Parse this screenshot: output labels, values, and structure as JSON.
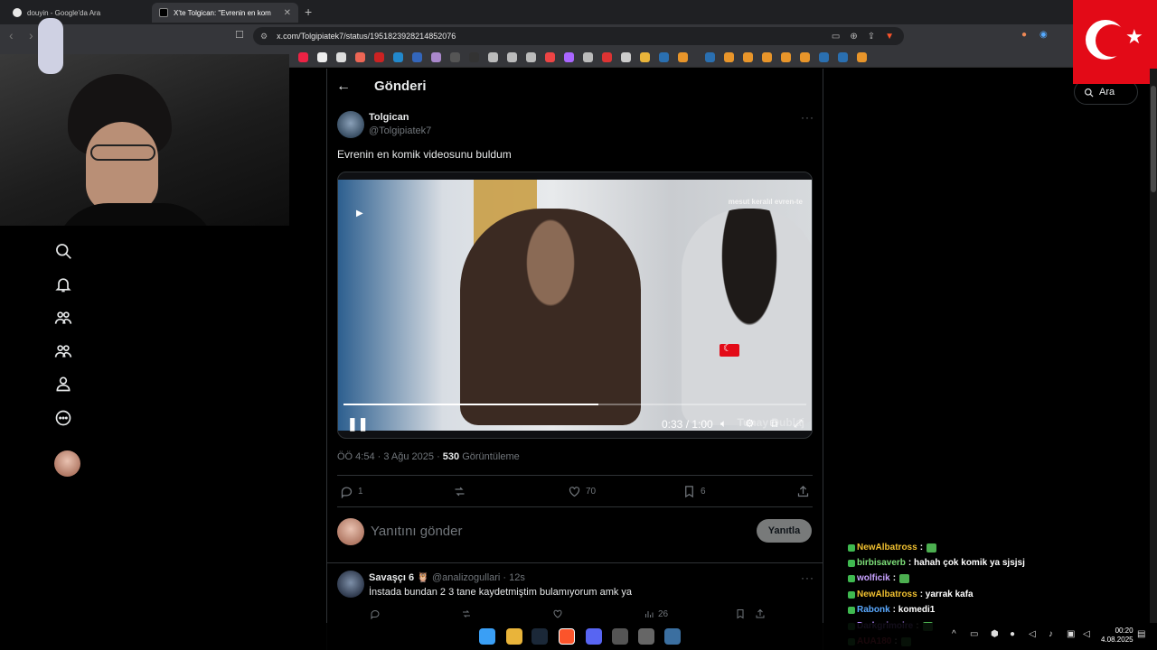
{
  "browser": {
    "tabs": [
      {
        "title": "douyin - Google'da Ara",
        "active": false
      },
      {
        "title": "X'te Tolgican: \"Evrenin en kom",
        "active": true
      }
    ],
    "url": "x.com/Tolgipiatek7/status/1951823928214852076"
  },
  "header": {
    "back": "←",
    "title": "Gönderi"
  },
  "tweet": {
    "author_name": "Tolgican",
    "author_handle": "@Tolgipiatek7",
    "text": "Evrenin en komik videosunu buldum",
    "time_prefix": "ÖÖ 4:54 · 3 Ağu 2025 · ",
    "views": "530",
    "views_label": " Görüntüleme",
    "replies": "1",
    "likes": "70",
    "bookmarks": "6"
  },
  "video": {
    "current": "0:33",
    "duration": "1:00",
    "time_display": "0:33 / 1:00",
    "progress_fraction": 0.55,
    "watermark_top": "mesut keralıl evren-te",
    "watermark_bottom": "Tunay Dublaj"
  },
  "reply_box": {
    "placeholder": "Yanıtını gönder",
    "button": "Yanıtla"
  },
  "comment": {
    "name": "Savaşçı 6 🦉",
    "handle": "@analizogullari · 12s",
    "text": "İnstada bundan 2  3 tane kaydetmiştim bulamıyorum amk ya",
    "views": "26"
  },
  "search": {
    "placeholder": "Ara"
  },
  "chat": [
    {
      "user": "NewAlbatross",
      "msg": ":",
      "color": "#f0c030"
    },
    {
      "user": "birbisaverb",
      "msg": ": hahah çok komik ya sjsjsj",
      "color": "#7ee07a"
    },
    {
      "user": "wolficik",
      "msg": ":",
      "color": "#c8a2ff"
    },
    {
      "user": "NewAlbatross",
      "msg": ": yarrak kafa",
      "color": "#f0c030"
    },
    {
      "user": "Rabonk",
      "msg": ": komedi1",
      "color": "#5aa9ff"
    },
    {
      "user": "Darkgrimoire",
      "msg": ":",
      "color": "#b388ff"
    },
    {
      "user": "AUA180",
      "msg": ":",
      "color": "#ff4d6d"
    }
  ],
  "clock": {
    "time": "00:20",
    "date": "4.08.2025"
  },
  "colors": {
    "accent": "#1d9bf0",
    "bg": "#000000",
    "border": "#2f3336",
    "muted": "#71767b"
  }
}
